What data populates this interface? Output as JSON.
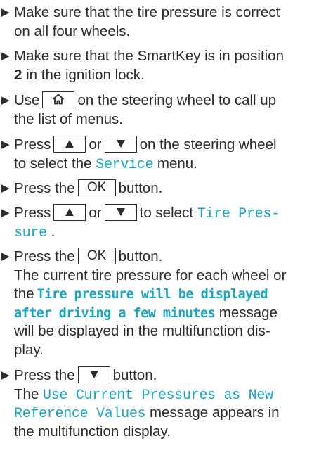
{
  "bullet_glyph": "▶",
  "keys": {
    "up_icon": "triangle-up-icon",
    "down_icon": "triangle-down-icon",
    "home_icon": "home-icon",
    "ok_label": "OK"
  },
  "colors": {
    "text": "#2b2b2b",
    "display_text": "#17a6c5"
  },
  "steps": [
    {
      "lines": [
        "Make sure that the tire pressure is correct",
        "on all four wheels."
      ]
    },
    {
      "lines": [
        "Make sure that the SmartKey is in position",
        "2",
        " in the ignition lock."
      ]
    },
    {
      "parts": [
        "Use",
        "on the steering wheel to call up",
        "the list of menus."
      ]
    },
    {
      "parts": [
        "Press",
        "or",
        "on the steering wheel",
        "to select the",
        "Service",
        "menu."
      ]
    },
    {
      "parts": [
        "Press the",
        "button."
      ]
    },
    {
      "parts": [
        "Press",
        "or",
        "to select",
        "Tire Pres-",
        "sure",
        " ."
      ]
    },
    {
      "parts": [
        "Press the",
        "button.",
        "The current tire pressure for each wheel or",
        "the",
        "Tire pressure will be displayed",
        "after driving a few minutes",
        "message",
        "will be displayed in the multifunction dis-",
        "play."
      ]
    },
    {
      "parts": [
        "Press the",
        "button.",
        "The",
        "Use Current Pressures as New",
        "Reference Values",
        "message appears in",
        "the multifunction display."
      ]
    }
  ]
}
